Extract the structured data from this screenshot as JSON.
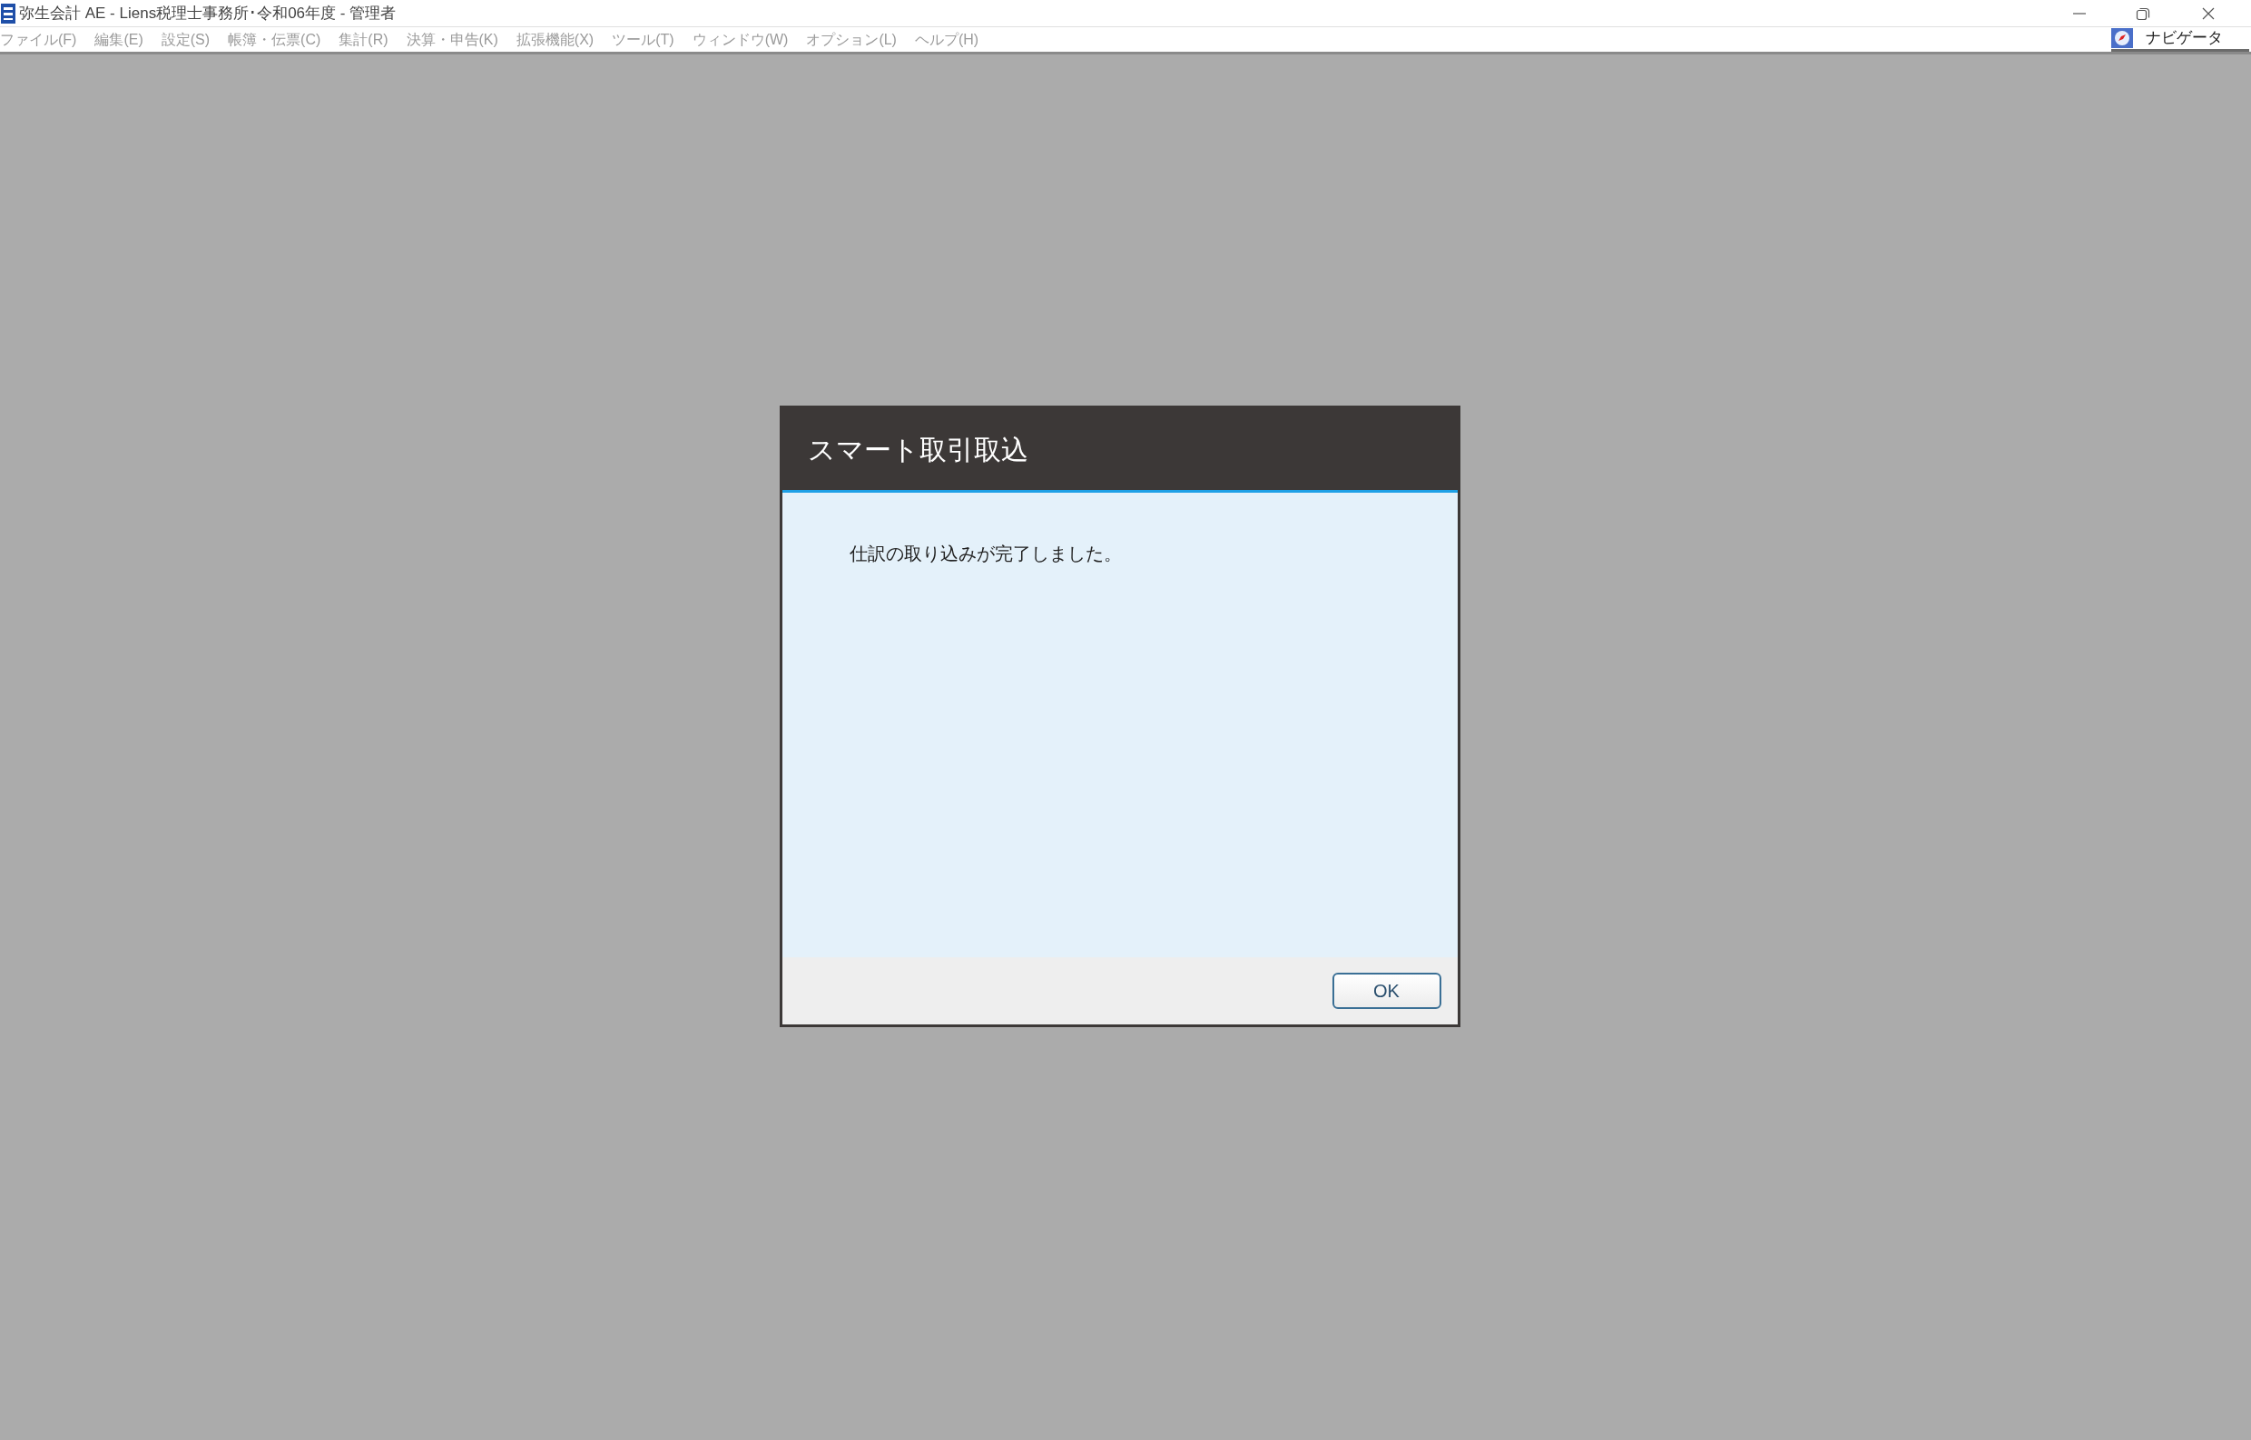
{
  "window": {
    "title": "弥生会計 AE - Liens税理士事務所･令和06年度 - 管理者"
  },
  "menu": [
    {
      "label": "ファイル(F)",
      "disabled": true
    },
    {
      "label": "編集(E)",
      "disabled": true
    },
    {
      "label": "設定(S)",
      "disabled": true
    },
    {
      "label": "帳簿・伝票(C)",
      "disabled": true
    },
    {
      "label": "集計(R)",
      "disabled": true
    },
    {
      "label": "決算・申告(K)",
      "disabled": true
    },
    {
      "label": "拡張機能(X)",
      "disabled": true
    },
    {
      "label": "ツール(T)",
      "disabled": true
    },
    {
      "label": "ウィンドウ(W)",
      "disabled": true
    },
    {
      "label": "オプション(L)",
      "disabled": true
    },
    {
      "label": "ヘルプ(H)",
      "disabled": true
    }
  ],
  "navigator": {
    "label": "ナビゲータ"
  },
  "dialog": {
    "title": "スマート取引取込",
    "message": "仕訳の取り込みが完了しました。",
    "buttons": [
      "OK"
    ]
  }
}
